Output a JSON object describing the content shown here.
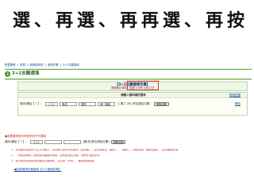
{
  "headline": "選、再選、再再選、再按",
  "breadcrumb": {
    "home": "學習歷程",
    "items": [
      " ＞ 首頁",
      " ＞ 服務與申請",
      " ＞ 選校作業",
      " ＞ 3+2志願選填"
    ]
  },
  "logo": {
    "badge": "3",
    "text": "3+2志願選填"
  },
  "title_bar": {
    "title": "【3+2志願選填作業】",
    "subtitle": "選填截止時間：民國 103年 5月27日"
  },
  "card": {
    "header_title": "請輸入擬申請的選系",
    "header_link": "新增志願",
    "row_label": "順序/類組【 ? 】：",
    "select1": "【 1 】",
    "select2": "食品",
    "select3": "餐飲",
    "select4": "第一類組",
    "relation_text": "【 類 】(系) 是否連結志願：",
    "button_label": "選取志願",
    "delete_link": "刪除"
  },
  "note_red": "●若要要申請不同校系請下列選填",
  "row2": {
    "label": "順序/類組【 ? 】：",
    "select1": "【 2 】",
    "select2": "",
    "select3": "",
    "relation_text": "[類(系)是否連結志願]",
    "button_label": "選取志願"
  },
  "hints": [
    "1、本系統採用選擇下拉方式輸入，請先輸入欲申請的順序（或名稱），並請選取出「類別」、「類別」，後選校按「確認志願」，並請確認選項。",
    "2、「序號或順序」應依照志願順序選填，若有重複的志願，系統會自動合併。",
    "3、若已經完成選填後請確認志願順序，並可按「列印」，確認選填結果。"
  ],
  "back_link": "●回到選填作業說明【3+2選填作業】"
}
